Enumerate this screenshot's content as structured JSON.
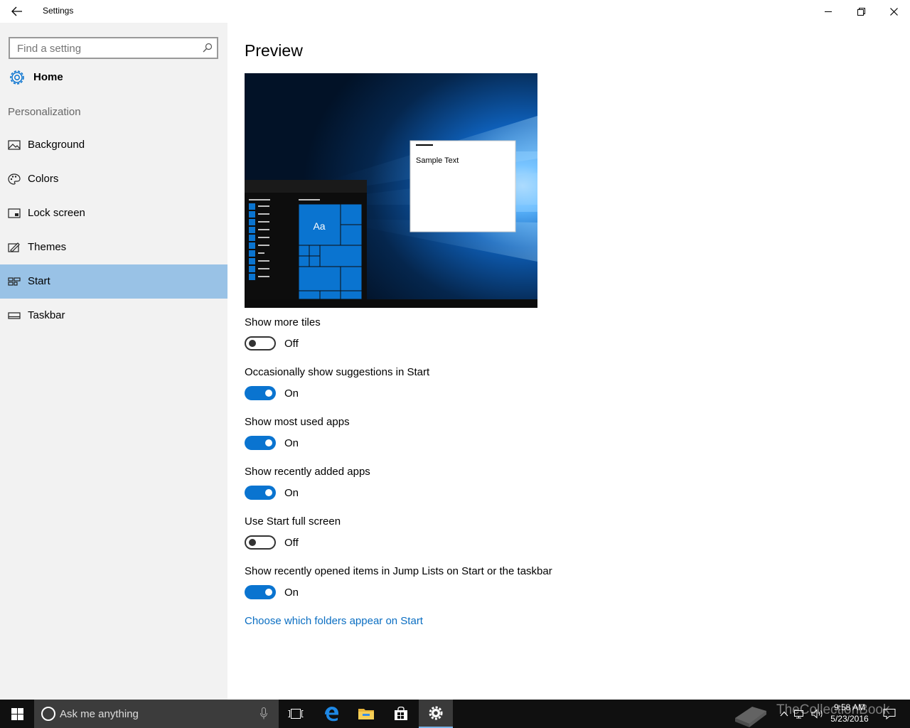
{
  "window": {
    "title": "Settings"
  },
  "sidebar": {
    "search_placeholder": "Find a setting",
    "home_label": "Home",
    "section_label": "Personalization",
    "items": [
      {
        "label": "Background",
        "icon": "picture-icon"
      },
      {
        "label": "Colors",
        "icon": "palette-icon"
      },
      {
        "label": "Lock screen",
        "icon": "lock-screen-icon"
      },
      {
        "label": "Themes",
        "icon": "brush-icon"
      },
      {
        "label": "Start",
        "icon": "start-layout-icon",
        "active": true
      },
      {
        "label": "Taskbar",
        "icon": "taskbar-icon"
      }
    ]
  },
  "main": {
    "title": "Preview",
    "preview_sample_text": "Sample Text",
    "preview_tile_text": "Aa",
    "settings": [
      {
        "label": "Show more tiles",
        "state": "Off"
      },
      {
        "label": "Occasionally show suggestions in Start",
        "state": "On"
      },
      {
        "label": "Show most used apps",
        "state": "On"
      },
      {
        "label": "Show recently added apps",
        "state": "On"
      },
      {
        "label": "Use Start full screen",
        "state": "Off"
      },
      {
        "label": "Show recently opened items in Jump Lists on Start or the taskbar",
        "state": "On"
      }
    ],
    "link": "Choose which folders appear on Start"
  },
  "taskbar": {
    "search_text": "Ask me anything",
    "time": "9:58 AM",
    "date": "5/23/2016",
    "watermark": "TheCollectionBook"
  },
  "colors": {
    "accent": "#0a74d0",
    "selected_nav": "#99c2e6",
    "link": "#0a6ec2",
    "taskbar": "#101010"
  }
}
